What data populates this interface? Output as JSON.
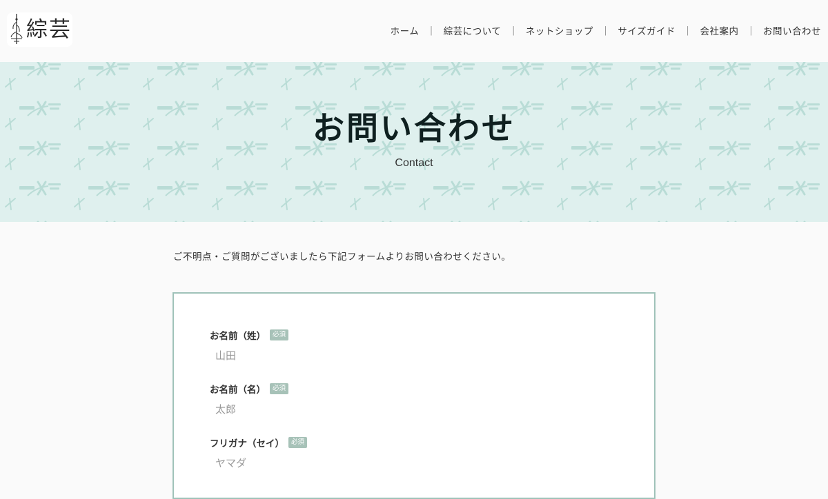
{
  "header": {
    "logo_text": "綜芸",
    "nav": [
      {
        "label": "ホーム"
      },
      {
        "label": "綜芸について"
      },
      {
        "label": "ネットショップ"
      },
      {
        "label": "サイズガイド"
      },
      {
        "label": "会社案内"
      },
      {
        "label": "お問い合わせ"
      }
    ],
    "separator": "｜"
  },
  "hero": {
    "title": "お問い合わせ",
    "subtitle": "Contact",
    "background_color": "#dff0ee",
    "pattern_color": "#b9dcd6"
  },
  "main": {
    "intro": "ご不明点・ご質問がございましたら下記フォームよりお問い合わせください。"
  },
  "form": {
    "border_color": "#9fc2b9",
    "required_badge": "必須",
    "fields": [
      {
        "label": "お名前（姓）",
        "placeholder": "山田"
      },
      {
        "label": "お名前（名）",
        "placeholder": "太郎"
      },
      {
        "label": "フリガナ（セイ）",
        "placeholder": "ヤマダ"
      }
    ]
  }
}
